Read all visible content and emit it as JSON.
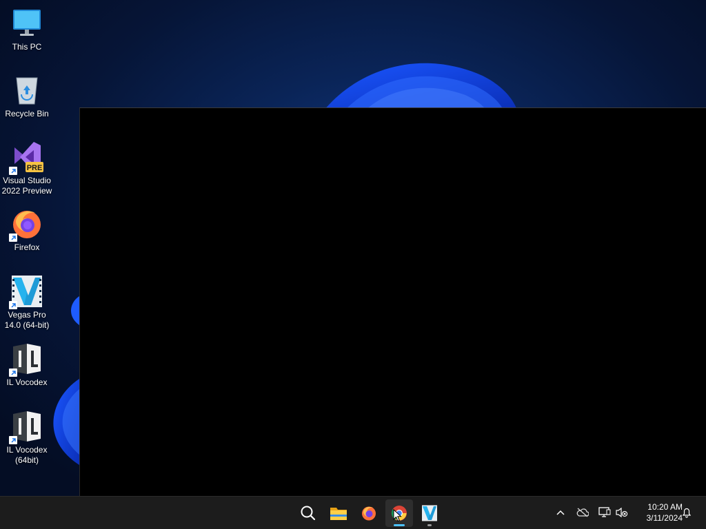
{
  "desktop": {
    "icons": [
      {
        "label": "This PC",
        "icon": "monitor-icon"
      },
      {
        "label": "Recycle Bin",
        "icon": "recycle-bin-icon"
      },
      {
        "label": "Visual Studio 2022 Preview",
        "icon": "visual-studio-icon",
        "badge": "PRE"
      },
      {
        "label": "Firefox",
        "icon": "firefox-icon"
      },
      {
        "label": "Vegas Pro 14.0 (64-bit)",
        "icon": "vegas-pro-icon"
      },
      {
        "label": "IL Vocodex",
        "icon": "il-vocodex-icon",
        "glyph_text": "IL"
      },
      {
        "label": "IL Vocodex (64bit)",
        "icon": "il-vocodex-icon",
        "glyph_text": "IL"
      }
    ]
  },
  "window": {
    "content": "black-blank-window"
  },
  "taskbar": {
    "apps": [
      {
        "name": "search",
        "icon": "search-icon"
      },
      {
        "name": "file-explorer",
        "icon": "folder-icon"
      },
      {
        "name": "firefox",
        "icon": "firefox-icon"
      },
      {
        "name": "chrome",
        "icon": "chrome-icon",
        "active": true
      },
      {
        "name": "vegas-pro",
        "icon": "vegas-pro-icon",
        "running": true
      }
    ],
    "tray": {
      "icons": [
        "chevron-up-icon",
        "onedrive-offline-icon",
        "network-icon",
        "volume-muted-icon",
        "notification-bell-icon"
      ],
      "time": "10:20 AM",
      "date": "3/11/2024"
    }
  },
  "colors": {
    "accent": "#4cc2ff",
    "taskbar": "#1c1c1c",
    "bloom": "#1f5cf0"
  }
}
